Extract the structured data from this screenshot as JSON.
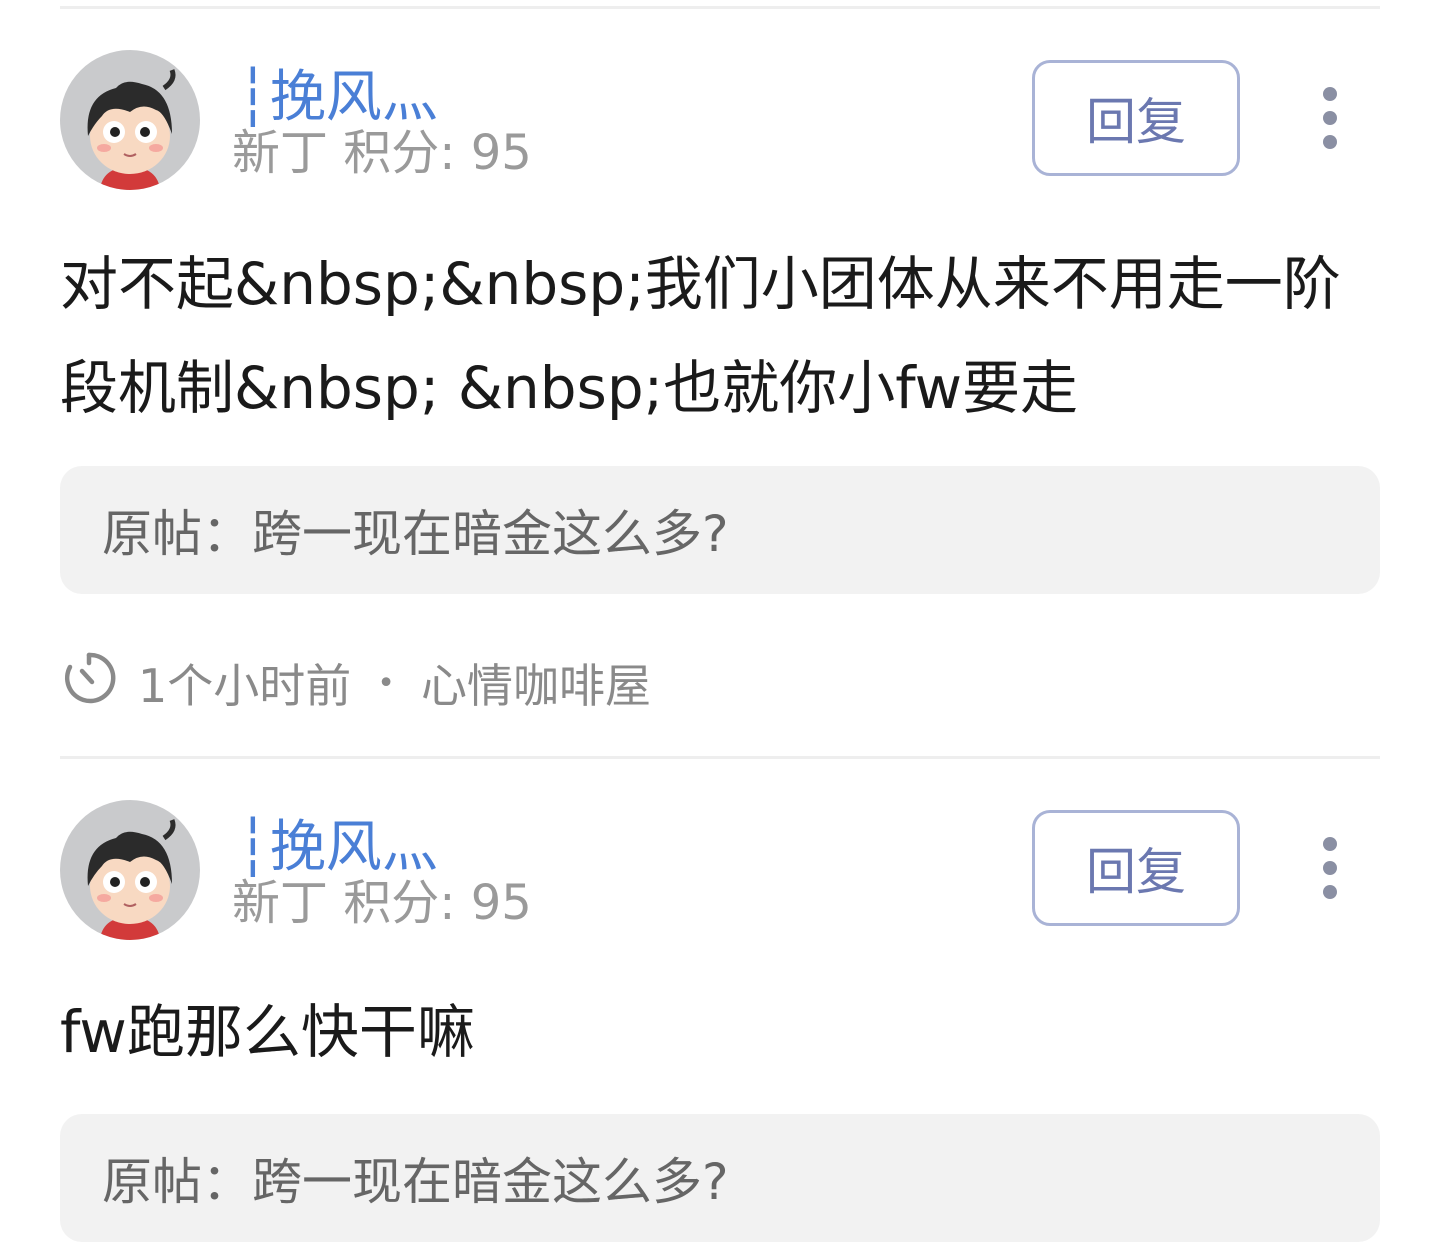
{
  "colors": {
    "username": "#4a7fd6",
    "meta": "#9a9a9a",
    "reply_border": "#a9b3d6",
    "reply_text": "#6b78b0",
    "quote_bg": "#f2f2f2"
  },
  "posts": [
    {
      "username": "┆挽风灬",
      "user_meta": "新丁 积分: 95",
      "reply_label": "回复",
      "content": "对不起&nbsp;&nbsp;我们小团体从来不用走一阶段机制&nbsp; &nbsp;也就你小fw要走",
      "original_post": "原帖：跨一现在暗金这么多?",
      "time": "1个小时前",
      "separator": "•",
      "forum": "心情咖啡屋",
      "icons": {
        "more": "more-vertical-icon",
        "clock": "clock-icon",
        "avatar": "cartoon-boy-avatar"
      }
    },
    {
      "username": "┆挽风灬",
      "user_meta": "新丁 积分: 95",
      "reply_label": "回复",
      "content": "fw跑那么快干嘛",
      "original_post": "原帖：跨一现在暗金这么多?",
      "icons": {
        "more": "more-vertical-icon",
        "avatar": "cartoon-boy-avatar"
      }
    }
  ]
}
